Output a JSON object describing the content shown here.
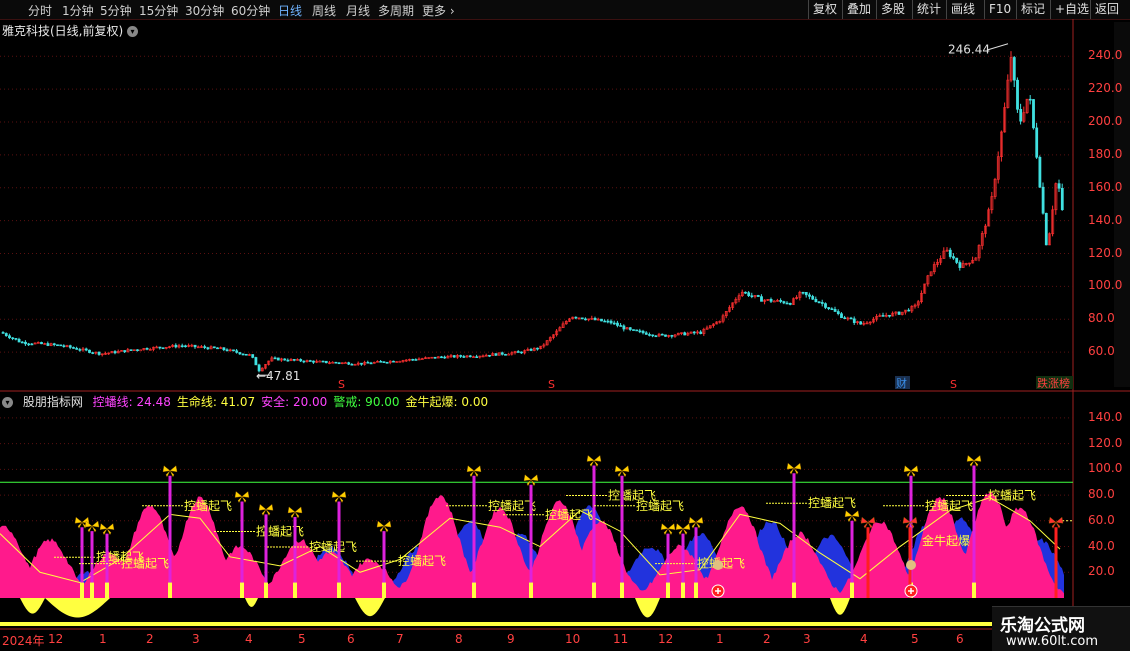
{
  "toolbar": {
    "periods": [
      "分时",
      "1分钟",
      "5分钟",
      "15分钟",
      "30分钟",
      "60分钟",
      "日线",
      "周线",
      "月线",
      "多周期",
      "更多"
    ],
    "active_period": "日线",
    "right_buttons": [
      "复权",
      "叠加",
      "多股",
      "统计",
      "画线",
      "F10",
      "标记",
      "+自选",
      "返回"
    ]
  },
  "stock": {
    "title": "雅克科技(日线,前复权)",
    "high_label": "246.44",
    "low_label": "47.81",
    "badges": [
      {
        "text": "财",
        "color": "#3a8ee6"
      },
      {
        "text": "跌涨榜",
        "color": "#22aa44"
      }
    ],
    "signal_marker": "S"
  },
  "indicator": {
    "name": "股朋指标网",
    "items": [
      {
        "label": "控蟠线:",
        "value": "24.48",
        "color": "#ff44ff"
      },
      {
        "label": "生命线:",
        "value": "41.07",
        "color": "#ffff40"
      },
      {
        "label": "安全:",
        "value": "20.00",
        "color": "#ff44ff"
      },
      {
        "label": "警戒:",
        "value": "90.00",
        "color": "#40ff40"
      },
      {
        "label": "金牛起爆:",
        "value": "0.00",
        "color": "#ffff40"
      }
    ],
    "signal_text": "控蟠起飞",
    "signal_text_alt": "金牛起爆",
    "colors": {
      "pink": "#ff1a8c",
      "blue": "#2233dd",
      "yellow": "#ffff40",
      "magenta": "#dd22dd",
      "green": "#40ff40",
      "red": "#ff2020"
    }
  },
  "axis": {
    "main_ticks": [
      "240.0",
      "220.0",
      "200.0",
      "180.0",
      "160.0",
      "140.0",
      "120.0",
      "100.0",
      "80.0",
      "60.0"
    ],
    "ind_ticks": [
      "140.0",
      "120.0",
      "100.0",
      "80.0",
      "60.0",
      "40.0",
      "20.0"
    ]
  },
  "dates": [
    "2024年",
    "12",
    "1",
    "2",
    "3",
    "4",
    "5",
    "6",
    "7",
    "8",
    "9",
    "10",
    "11",
    "12",
    "1",
    "2",
    "3",
    "4",
    "5",
    "6"
  ],
  "watermark": {
    "title": "乐淘公式网",
    "url": "www.60lt.com"
  },
  "chart_data": [
    {
      "type": "candlestick",
      "title": "雅克科技(日线,前复权)",
      "ylim": [
        40,
        256
      ],
      "price_path": [
        [
          0,
          72
        ],
        [
          20,
          66
        ],
        [
          60,
          64
        ],
        [
          100,
          59
        ],
        [
          140,
          62
        ],
        [
          180,
          64
        ],
        [
          220,
          62
        ],
        [
          250,
          58
        ],
        [
          258,
          49
        ],
        [
          270,
          56
        ],
        [
          320,
          54
        ],
        [
          360,
          53
        ],
        [
          400,
          55
        ],
        [
          440,
          57
        ],
        [
          480,
          58
        ],
        [
          520,
          60
        ],
        [
          540,
          63
        ],
        [
          555,
          72
        ],
        [
          570,
          82
        ],
        [
          590,
          80
        ],
        [
          610,
          78
        ],
        [
          630,
          73
        ],
        [
          660,
          70
        ],
        [
          700,
          72
        ],
        [
          720,
          80
        ],
        [
          740,
          97
        ],
        [
          760,
          92
        ],
        [
          790,
          90
        ],
        [
          800,
          96
        ],
        [
          820,
          90
        ],
        [
          840,
          82
        ],
        [
          860,
          77
        ],
        [
          880,
          82
        ],
        [
          900,
          84
        ],
        [
          915,
          88
        ],
        [
          930,
          110
        ],
        [
          945,
          122
        ],
        [
          960,
          112
        ],
        [
          975,
          118
        ],
        [
          990,
          150
        ],
        [
          1002,
          200
        ],
        [
          1010,
          240
        ],
        [
          1018,
          198
        ],
        [
          1028,
          218
        ],
        [
          1036,
          178
        ],
        [
          1046,
          122
        ],
        [
          1056,
          168
        ],
        [
          1062,
          142
        ]
      ],
      "annotations": [
        {
          "text": "246.44",
          "x": 1008,
          "y": 246.44
        },
        {
          "text": "47.81",
          "x": 256,
          "y": 47.81
        }
      ]
    },
    {
      "type": "area",
      "title": "股朋指标网",
      "ylim": [
        0,
        150
      ],
      "reference_lines": [
        {
          "name": "警戒",
          "value": 90
        }
      ],
      "pink_peaks": [
        [
          5,
          55
        ],
        [
          50,
          45
        ],
        [
          110,
          35
        ],
        [
          150,
          72
        ],
        [
          200,
          78
        ],
        [
          240,
          40
        ],
        [
          300,
          45
        ],
        [
          330,
          35
        ],
        [
          370,
          30
        ],
        [
          440,
          80
        ],
        [
          500,
          70
        ],
        [
          560,
          75
        ],
        [
          600,
          60
        ],
        [
          680,
          40
        ],
        [
          740,
          72
        ],
        [
          800,
          50
        ],
        [
          880,
          60
        ],
        [
          940,
          78
        ],
        [
          990,
          82
        ],
        [
          1020,
          70
        ]
      ],
      "blue_peaks": [
        [
          20,
          25
        ],
        [
          90,
          20
        ],
        [
          190,
          40
        ],
        [
          240,
          35
        ],
        [
          330,
          40
        ],
        [
          420,
          40
        ],
        [
          470,
          60
        ],
        [
          520,
          50
        ],
        [
          590,
          72
        ],
        [
          650,
          40
        ],
        [
          700,
          50
        ],
        [
          770,
          60
        ],
        [
          830,
          48
        ],
        [
          930,
          60
        ],
        [
          960,
          62
        ],
        [
          1040,
          45
        ]
      ],
      "yellow_line": [
        [
          0,
          50
        ],
        [
          40,
          20
        ],
        [
          80,
          12
        ],
        [
          120,
          30
        ],
        [
          170,
          65
        ],
        [
          200,
          62
        ],
        [
          230,
          32
        ],
        [
          280,
          25
        ],
        [
          320,
          40
        ],
        [
          360,
          20
        ],
        [
          400,
          30
        ],
        [
          450,
          62
        ],
        [
          500,
          55
        ],
        [
          540,
          40
        ],
        [
          580,
          68
        ],
        [
          620,
          52
        ],
        [
          660,
          18
        ],
        [
          700,
          22
        ],
        [
          740,
          65
        ],
        [
          780,
          58
        ],
        [
          820,
          35
        ],
        [
          860,
          15
        ],
        [
          900,
          40
        ],
        [
          950,
          68
        ],
        [
          990,
          78
        ],
        [
          1030,
          60
        ],
        [
          1060,
          38
        ]
      ],
      "negative_regions": [
        [
          20,
          45,
          -12
        ],
        [
          45,
          110,
          -15
        ],
        [
          245,
          258,
          -7
        ],
        [
          355,
          385,
          -14
        ],
        [
          635,
          660,
          -15
        ],
        [
          830,
          850,
          -13
        ]
      ],
      "signals": [
        {
          "x": 82,
          "top": 55
        },
        {
          "x": 92,
          "top": 52
        },
        {
          "x": 107,
          "top": 50
        },
        {
          "x": 170,
          "top": 95
        },
        {
          "x": 242,
          "top": 75
        },
        {
          "x": 266,
          "top": 65
        },
        {
          "x": 295,
          "top": 63
        },
        {
          "x": 339,
          "top": 75
        },
        {
          "x": 384,
          "top": 52
        },
        {
          "x": 474,
          "top": 95
        },
        {
          "x": 531,
          "top": 88
        },
        {
          "x": 594,
          "top": 103
        },
        {
          "x": 622,
          "top": 95
        },
        {
          "x": 668,
          "top": 50
        },
        {
          "x": 683,
          "top": 50
        },
        {
          "x": 696,
          "top": 55
        },
        {
          "x": 794,
          "top": 97
        },
        {
          "x": 852,
          "top": 60
        },
        {
          "x": 911,
          "top": 95
        },
        {
          "x": 974,
          "top": 103
        }
      ],
      "red_signals": [
        {
          "x": 868,
          "top": 55
        },
        {
          "x": 910,
          "top": 55
        },
        {
          "x": 1056,
          "top": 55
        }
      ]
    }
  ]
}
